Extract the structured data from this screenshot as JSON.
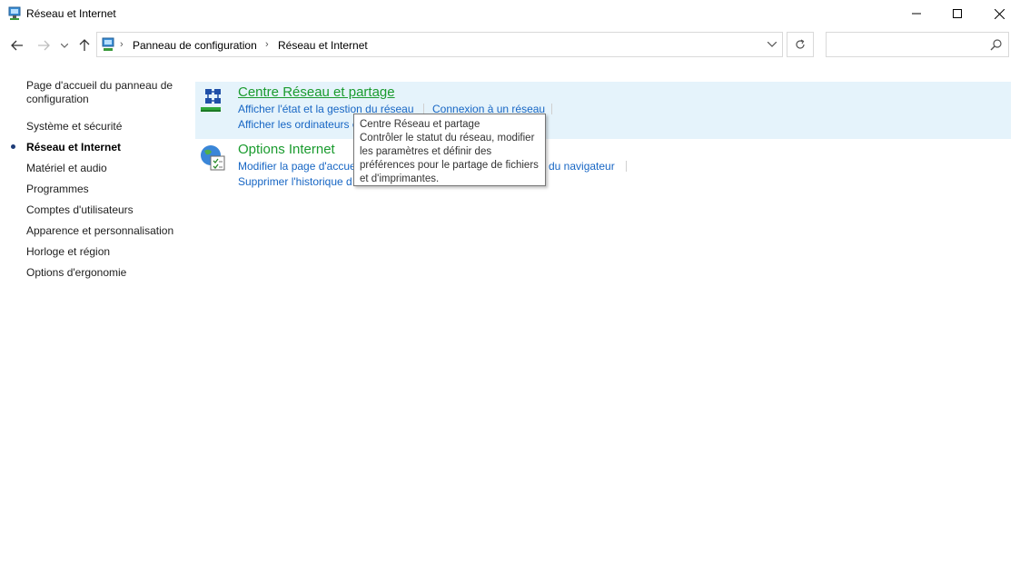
{
  "window": {
    "title": "Réseau et Internet"
  },
  "address": {
    "crumbs": [
      "Panneau de configuration",
      "Réseau et Internet"
    ]
  },
  "search": {
    "placeholder": "",
    "value": ""
  },
  "sidebar": {
    "items": [
      {
        "label": "Page d'accueil du panneau de",
        "label2": "configuration"
      },
      {
        "label": "Système et sécurité"
      },
      {
        "label": "Réseau et Internet",
        "active": true
      },
      {
        "label": "Matériel et audio"
      },
      {
        "label": "Programmes"
      },
      {
        "label": "Comptes d'utilisateurs"
      },
      {
        "label": "Apparence et personnalisation"
      },
      {
        "label": "Horloge et région"
      },
      {
        "label": "Options d'ergonomie"
      }
    ]
  },
  "categories": [
    {
      "title": "Centre Réseau et partage",
      "tasks": [
        "Afficher l'état et la gestion du réseau",
        "Connexion à un réseau",
        "Afficher les ordinateurs e"
      ]
    },
    {
      "title": "Options Internet",
      "tasks": [
        "Modifier la page d'accue",
        "du navigateur",
        "Supprimer l'historique d"
      ]
    }
  ],
  "tooltip": {
    "lines": [
      "Centre Réseau et partage",
      "Contrôler le statut du réseau, modifier",
      "les paramètres et définir des",
      "préférences pour le partage de fichiers",
      "et d'imprimantes."
    ]
  },
  "colors": {
    "category_title": "#1a9b2e",
    "link": "#1766c4",
    "highlight": "#e5f3fb"
  }
}
